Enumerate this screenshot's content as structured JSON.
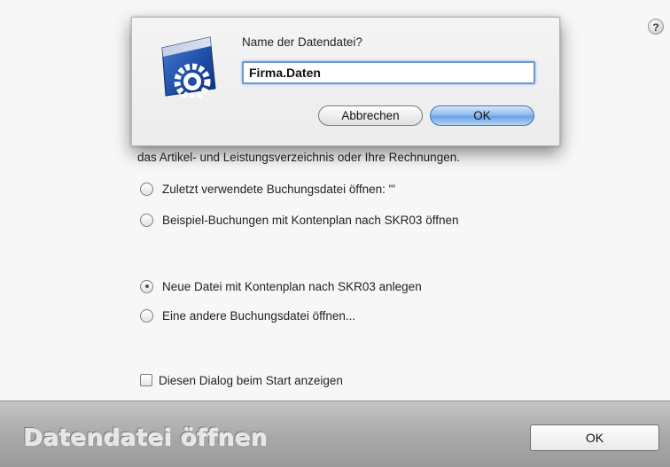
{
  "help": {
    "label": "?"
  },
  "intro": {
    "text": "das Artikel- und Leistungsverzeichnis oder Ihre Rechnungen."
  },
  "options": [
    {
      "label": "Zuletzt verwendete Buchungsdatei öffnen:  \"'",
      "checked": false
    },
    {
      "label": "Beispiel-Buchungen mit Kontenplan nach SKR03 öffnen",
      "checked": false
    },
    {
      "label": "Neue Datei mit Kontenplan nach SKR03 anlegen",
      "checked": true
    },
    {
      "label": "Eine andere Buchungsdatei öffnen...",
      "checked": false
    }
  ],
  "startup_checkbox": {
    "label": "Diesen Dialog beim Start anzeigen",
    "checked": false
  },
  "footer": {
    "title": "Datendatei öffnen",
    "ok_label": "OK"
  },
  "sheet": {
    "prompt": "Name der Datendatei?",
    "filename_value": "Firma.Daten",
    "cancel_label": "Abbrechen",
    "ok_label": "OK"
  },
  "colors": {
    "focus_ring": "#6c98d2",
    "default_button": "#6aa3e6"
  }
}
